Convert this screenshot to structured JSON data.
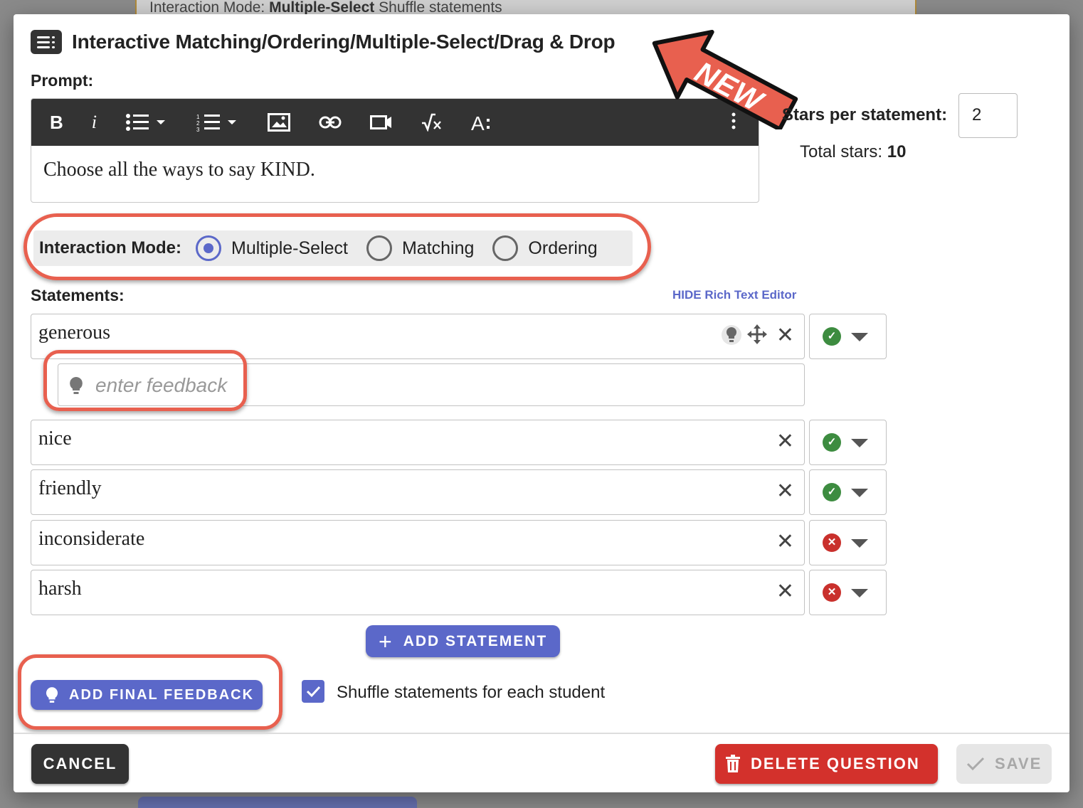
{
  "background": {
    "strip_prefix": "Interaction Mode: ",
    "strip_mode": "Multiple-Select",
    "strip_suffix": "  Shuffle statements"
  },
  "dialog": {
    "title": "Interactive Matching/Ordering/Multiple-Select/Drag & Drop",
    "prompt_label": "Prompt:",
    "prompt_text": "Choose all the ways to say KIND.",
    "stars_label": "Stars per statement:",
    "stars_value": "2",
    "total_stars_label": "Total stars: ",
    "total_stars_value": "10",
    "new_badge": "NEW"
  },
  "interaction_mode": {
    "label": "Interaction Mode:",
    "options": [
      "Multiple-Select",
      "Matching",
      "Ordering"
    ],
    "selected": "Multiple-Select"
  },
  "statements": {
    "label": "Statements:",
    "hide_rte_link": "HIDE Rich Text Editor",
    "feedback_placeholder": "enter feedback",
    "items": [
      {
        "text": "generous",
        "correct": true
      },
      {
        "text": "nice",
        "correct": true
      },
      {
        "text": "friendly",
        "correct": true
      },
      {
        "text": "inconsiderate",
        "correct": false
      },
      {
        "text": "harsh",
        "correct": false
      }
    ],
    "add_button": "ADD STATEMENT"
  },
  "footer": {
    "final_feedback_button": "ADD FINAL FEEDBACK",
    "shuffle_label": "Shuffle statements for each student",
    "shuffle_checked": true,
    "cancel": "CANCEL",
    "delete": "DELETE QUESTION",
    "save": "SAVE"
  },
  "colors": {
    "accent": "#5b68c9",
    "highlight": "#e8604f",
    "correct": "#3d8c40",
    "incorrect": "#c9302c",
    "delete": "#d3312c"
  }
}
